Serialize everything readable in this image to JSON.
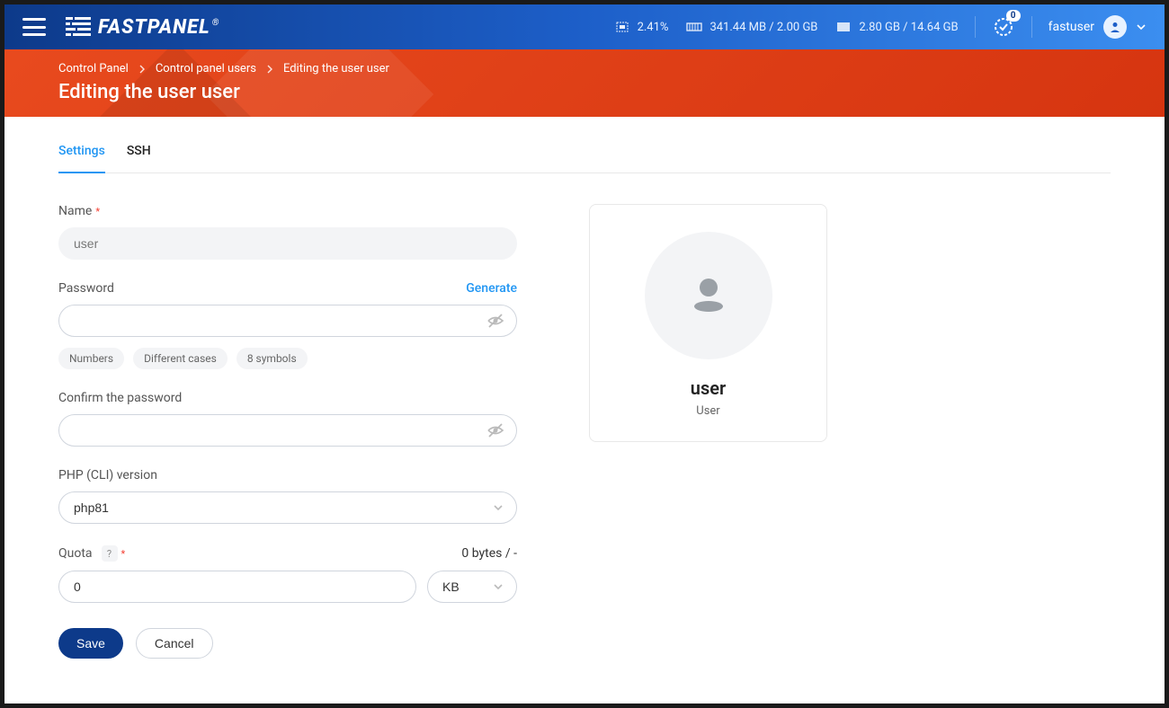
{
  "topbar": {
    "cpu": "2.41%",
    "memory": "341.44 MB / 2.00 GB",
    "disk": "2.80 GB / 14.64 GB",
    "notif_count": "0",
    "username": "fastuser",
    "logo_text": "FASTPANEL"
  },
  "breadcrumb": {
    "items": [
      "Control Panel",
      "Control panel users",
      "Editing the user user"
    ]
  },
  "page_title": "Editing the user user",
  "tabs": {
    "settings": "Settings",
    "ssh": "SSH"
  },
  "form": {
    "name_label": "Name",
    "name_value": "user",
    "password_label": "Password",
    "generate_label": "Generate",
    "chips": [
      "Numbers",
      "Different cases",
      "8 symbols"
    ],
    "confirm_label": "Confirm the password",
    "php_label": "PHP (CLI) version",
    "php_value": "php81",
    "quota_label": "Quota",
    "quota_help": "?",
    "quota_usage": "0 bytes / -",
    "quota_value": "0",
    "quota_unit": "KB"
  },
  "actions": {
    "save": "Save",
    "cancel": "Cancel"
  },
  "user_card": {
    "name": "user",
    "role": "User"
  }
}
